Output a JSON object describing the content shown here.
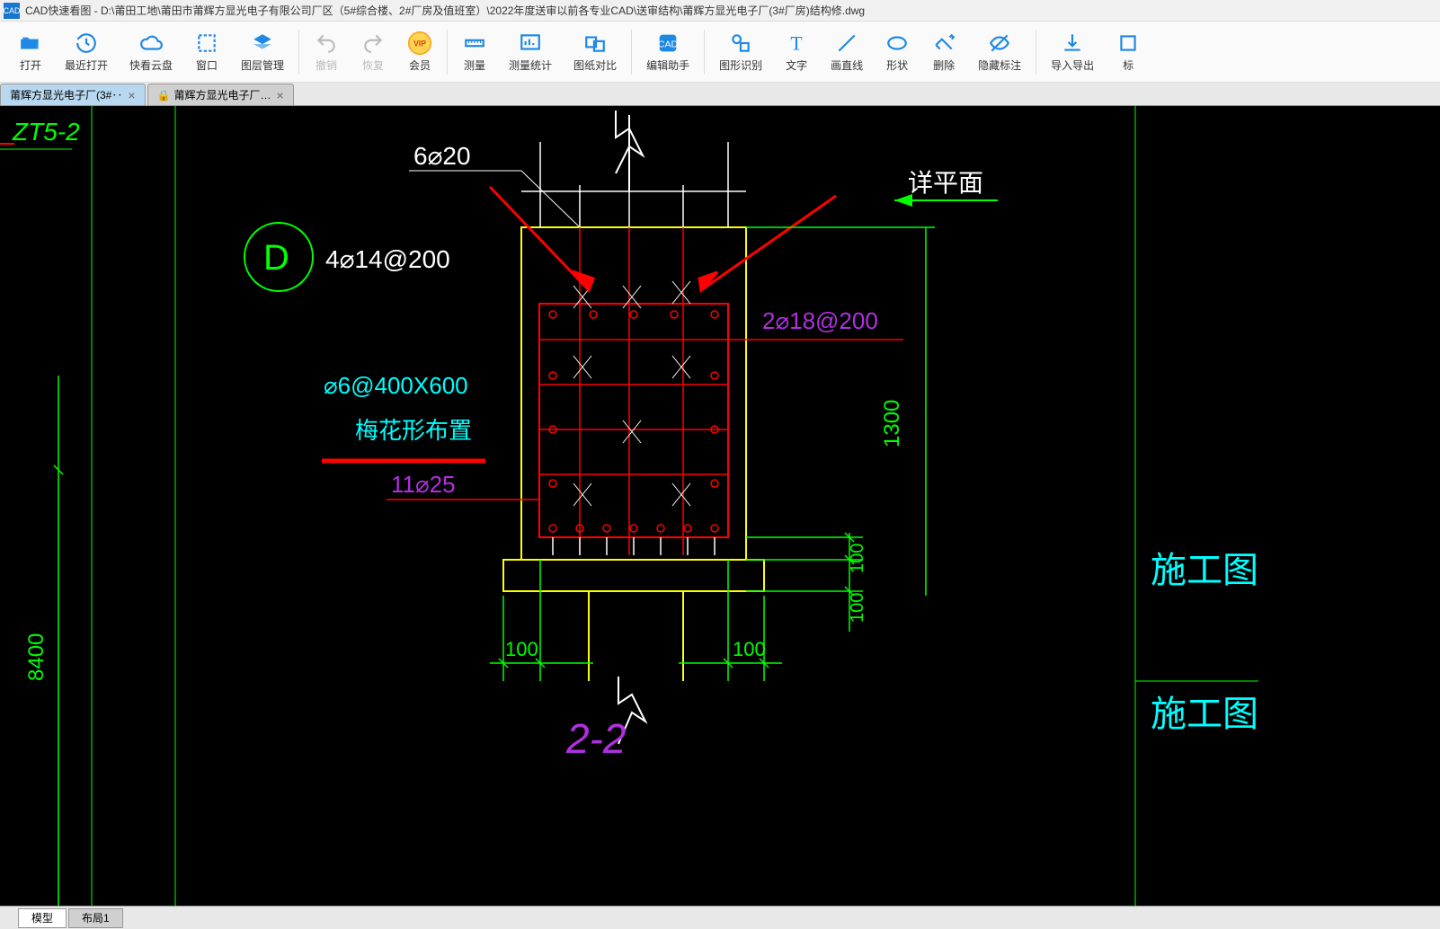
{
  "title": {
    "app": "CAD快速看图",
    "path": "D:\\莆田工地\\莆田市莆辉方显光电子有限公司厂区（5#综合楼、2#厂房及值班室）\\2022年度送审以前各专业CAD\\送审结构\\莆辉方显光电子厂(3#厂房)结构修.dwg"
  },
  "toolbar": [
    {
      "label": "打开",
      "icon": "folder-open-icon",
      "color": "#1e88e5"
    },
    {
      "label": "最近打开",
      "icon": "history-icon",
      "color": "#1e88e5"
    },
    {
      "label": "快看云盘",
      "icon": "cloud-icon",
      "color": "#1e88e5"
    },
    {
      "label": "窗口",
      "icon": "window-icon",
      "color": "#1e88e5"
    },
    {
      "label": "图层管理",
      "icon": "layers-icon",
      "color": "#1e88e5"
    },
    {
      "sep": true
    },
    {
      "label": "撤销",
      "icon": "undo-icon",
      "color": "#bbb",
      "disabled": true
    },
    {
      "label": "恢复",
      "icon": "redo-icon",
      "color": "#bbb",
      "disabled": true
    },
    {
      "label": "会员",
      "icon": "vip-icon",
      "color": "#f9a825"
    },
    {
      "sep": true
    },
    {
      "label": "测量",
      "icon": "measure-icon",
      "color": "#1e88e5"
    },
    {
      "label": "测量统计",
      "icon": "stats-icon",
      "color": "#1e88e5"
    },
    {
      "label": "图纸对比",
      "icon": "compare-icon",
      "color": "#1e88e5"
    },
    {
      "sep": true
    },
    {
      "label": "编辑助手",
      "icon": "edit-assist-icon",
      "color": "#1e88e5"
    },
    {
      "sep": true
    },
    {
      "label": "图形识别",
      "icon": "shape-rec-icon",
      "color": "#1e88e5"
    },
    {
      "label": "文字",
      "icon": "text-icon",
      "color": "#1e88e5"
    },
    {
      "label": "画直线",
      "icon": "line-icon",
      "color": "#1e88e5"
    },
    {
      "label": "形状",
      "icon": "shape-icon",
      "color": "#1e88e5"
    },
    {
      "label": "删除",
      "icon": "delete-icon",
      "color": "#1e88e5"
    },
    {
      "label": "隐藏标注",
      "icon": "hide-icon",
      "color": "#1e88e5"
    },
    {
      "sep": true
    },
    {
      "label": "导入导出",
      "icon": "import-export-icon",
      "color": "#1e88e5"
    },
    {
      "label": "标",
      "icon": "mark-icon",
      "color": "#1e88e5"
    }
  ],
  "tabs": [
    {
      "label": "莆辉方显光电子厂(3#‥",
      "active": true
    },
    {
      "label": "莆辉方显光电子厂…",
      "locked": true
    }
  ],
  "bottom_tabs": [
    {
      "label": "模型",
      "active": true
    },
    {
      "label": "布局1",
      "active": false
    }
  ],
  "drawing": {
    "grid_label_top_left": "ZT5-2",
    "section_label": "2-2",
    "rebar_6_20": "6⌀20",
    "rebar_4_14_200": "4⌀14@200",
    "rebar_2_18_200": "2⌀18@200",
    "rebar_6_400_600": "⌀6@400X600",
    "plum_blossom": "梅花形布置",
    "rebar_11_25": "11⌀25",
    "detail_plan": "详平面",
    "dim_1300": "1300",
    "dim_100_a": "100",
    "dim_100_b": "100",
    "dim_100_c": "100",
    "dim_100_d": "100",
    "dim_8400": "8400",
    "grid_D": "D",
    "watermark_1": "施工图",
    "watermark_2": "施工图"
  }
}
